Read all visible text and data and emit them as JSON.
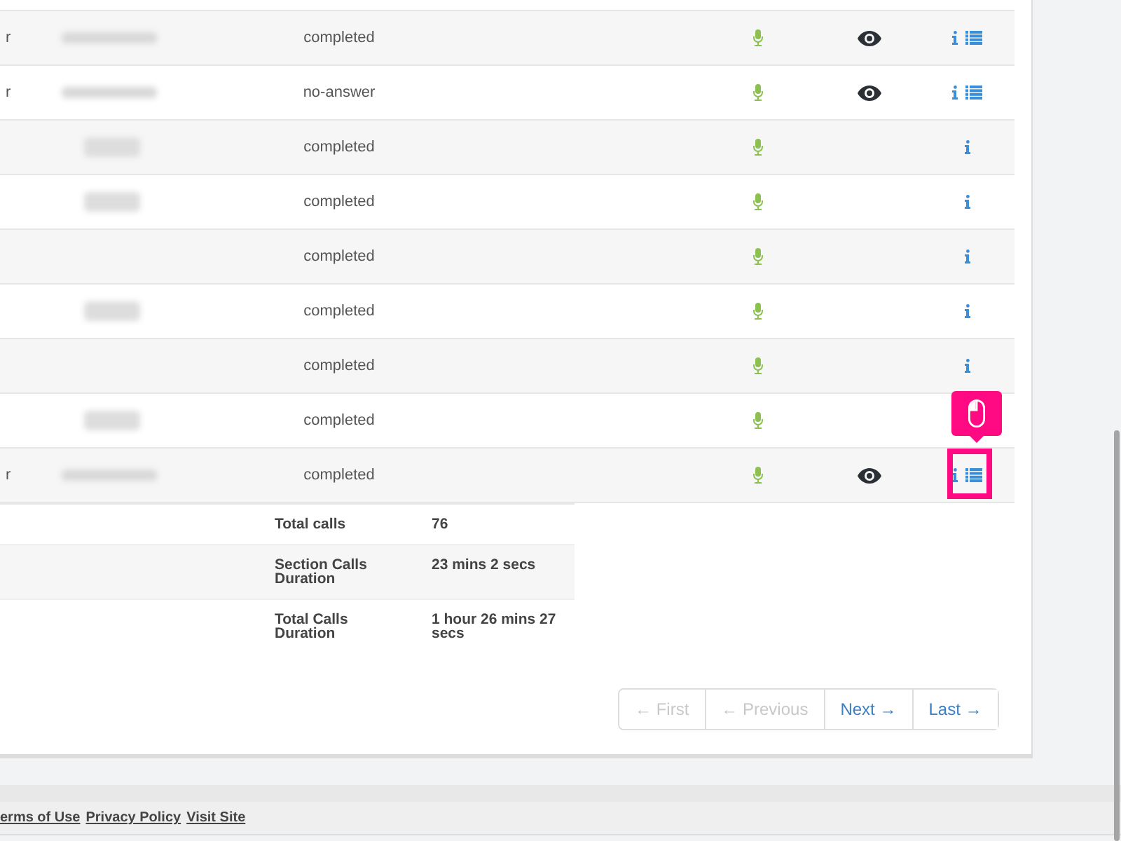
{
  "calls": [
    {
      "column_1": "r",
      "kind": "short",
      "status": "completed",
      "recording": true,
      "viewed": true,
      "info": true,
      "details": true,
      "highlighted": false
    },
    {
      "column_1": "r",
      "kind": "short",
      "status": "no-answer",
      "recording": true,
      "viewed": true,
      "info": true,
      "details": true,
      "highlighted": false
    },
    {
      "kind": "stacked",
      "status": "completed",
      "recording": true,
      "viewed": false,
      "info": true,
      "details": false,
      "highlighted": false
    },
    {
      "kind": "stacked",
      "status": "completed",
      "recording": true,
      "viewed": false,
      "info": true,
      "details": false,
      "highlighted": false
    },
    {
      "kind": "empty",
      "status": "completed",
      "recording": true,
      "viewed": false,
      "info": true,
      "details": false,
      "highlighted": false
    },
    {
      "kind": "stacked",
      "status": "completed",
      "recording": true,
      "viewed": false,
      "info": true,
      "details": false,
      "highlighted": false
    },
    {
      "kind": "empty",
      "status": "completed",
      "recording": true,
      "viewed": false,
      "info": true,
      "details": false,
      "highlighted": false
    },
    {
      "kind": "stacked",
      "status": "completed",
      "recording": true,
      "viewed": false,
      "info": false,
      "details": false,
      "highlighted": false
    },
    {
      "column_1": "r",
      "kind": "short",
      "status": "completed",
      "recording": true,
      "viewed": true,
      "info": true,
      "details": true,
      "highlighted": true
    }
  ],
  "summary": [
    {
      "label": "Total calls",
      "value": "76"
    },
    {
      "label": "Section Calls Duration",
      "value": "23 mins 2 secs"
    },
    {
      "label": "Total Calls Duration",
      "value": "1 hour 26 mins 27 secs"
    }
  ],
  "pagination": [
    {
      "label": "← First",
      "disabled": true
    },
    {
      "label": "← Previous",
      "disabled": true
    },
    {
      "label": "Next →",
      "disabled": false
    },
    {
      "label": "Last →",
      "disabled": false
    }
  ],
  "footer_links": [
    "erms of Use",
    "Privacy Policy",
    "Visit Site"
  ]
}
